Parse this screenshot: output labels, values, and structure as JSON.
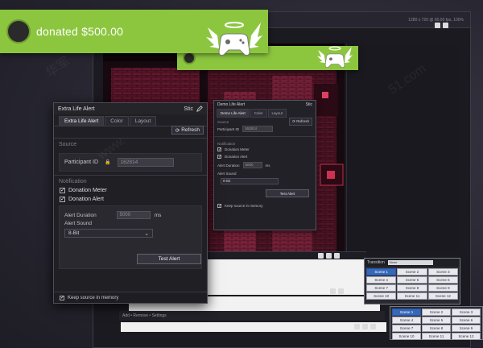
{
  "alert": {
    "main_text": "donated $500.00",
    "back_text": ""
  },
  "obs": {
    "stats": "1280 x 720 @ 60.00 fps, 100%",
    "zoom": "100%",
    "footer_label": "Add  •  Remove  •  Settings"
  },
  "scenes": {
    "header_label": "Transition",
    "dropdown_value": "None",
    "top_buttons": [
      "Scene 1",
      "Scene 2",
      "Scene 3",
      "Scene 4",
      "Scene 5",
      "Scene 6",
      "Scene 7",
      "Scene 8",
      "Scene 9",
      "Scene 10",
      "Scene 11",
      "Scene 12"
    ],
    "bottom_buttons": [
      "Scene 1",
      "Scene 2",
      "Scene 3",
      "Scene 4",
      "Scene 5",
      "Scene 6",
      "Scene 7",
      "Scene 8",
      "Scene 9",
      "Scene 10",
      "Scene 11",
      "Scene 12"
    ]
  },
  "dialog_mid": {
    "title": "Demo Life Alert",
    "ctrl": "Stic",
    "tabs": [
      "Demo Life Alert",
      "Color",
      "Layout"
    ],
    "refresh_label": "Refresh",
    "source_label": "Source",
    "pid_label": "Participant ID",
    "pid_value": "162814",
    "notification_label": "Notification",
    "check1": "Donation Meter",
    "check2": "Donation Alert",
    "duration_label": "Alert Duration",
    "duration_value": "5000",
    "duration_unit": "ms",
    "sound_label": "Alert Sound",
    "sound_value": "8-Bit",
    "test_label": "Test Alert",
    "footer_check": "Keep source in memory"
  },
  "dialog_main": {
    "title": "Extra Life Alert",
    "ctrl": "Stic",
    "tabs": [
      "Extra Life Alert",
      "Color",
      "Layout"
    ],
    "refresh_label": "Refresh",
    "source_label": "Source",
    "pid_label": "Participant ID",
    "pid_value": "162814",
    "notification_label": "Notification",
    "check_meter": "Donation Meter",
    "check_alert": "Donation Alert",
    "duration_label": "Alert Duration",
    "duration_value": "5000",
    "duration_unit": "ms",
    "sound_label": "Alert Sound",
    "sound_value": "8-Bit",
    "test_label": "Test Alert",
    "footer_check": "Keep source in memory"
  },
  "watermarks": [
    "华军",
    "www.",
    "51.com"
  ],
  "colors": {
    "alert_green": "#8cc63f",
    "dialog_bg": "#1f1f24",
    "scene_active": "#3568b8",
    "game_red": "#c0304a"
  }
}
